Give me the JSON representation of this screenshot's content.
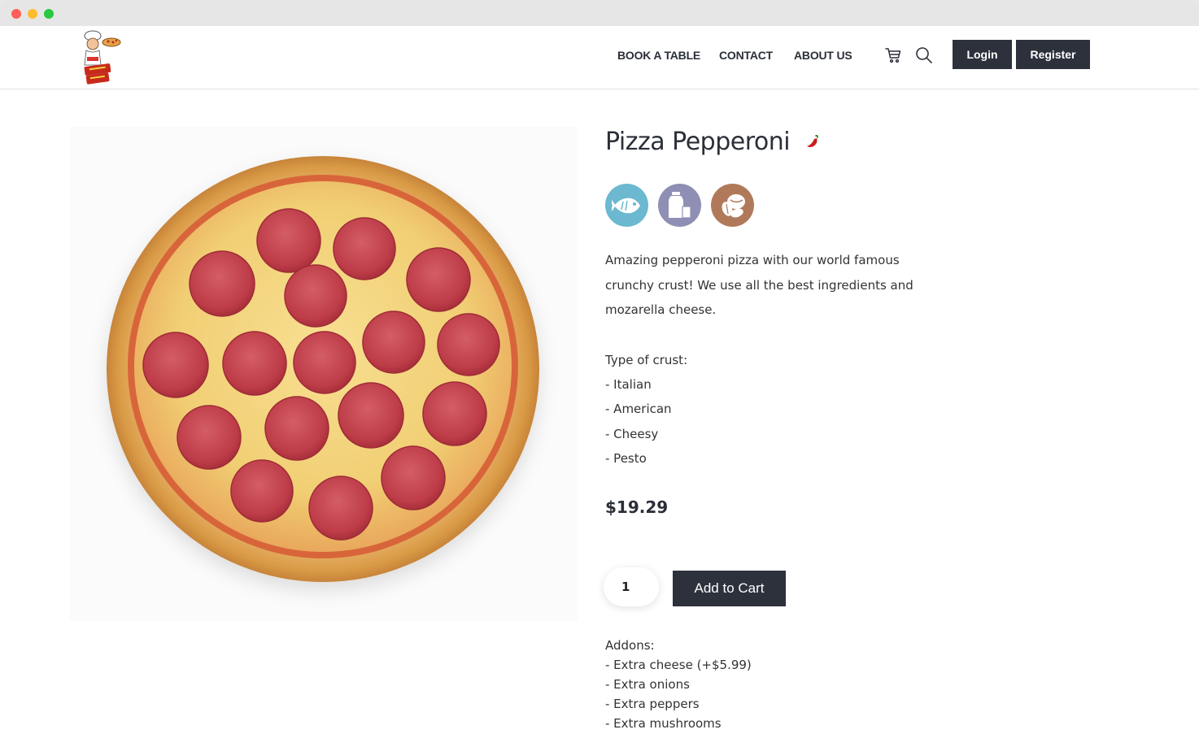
{
  "window": {
    "title": ""
  },
  "header": {
    "logo_alt": "Pizza logo",
    "nav": [
      {
        "label": "BOOK A TABLE"
      },
      {
        "label": "CONTACT"
      },
      {
        "label": "ABOUT US"
      }
    ],
    "cart_icon": "cart-icon",
    "search_icon": "search-icon",
    "login_label": "Login",
    "register_label": "Register"
  },
  "product": {
    "name": "Pizza Pepperoni",
    "spicy_icon": "chili-icon",
    "allergens": [
      {
        "name": "fish-icon",
        "color": "#6bb8d0"
      },
      {
        "name": "milk-icon",
        "color": "#8f8fb5"
      },
      {
        "name": "nuts-icon",
        "color": "#b07a5a"
      }
    ],
    "description_lines": [
      "Amazing pepperoni pizza with our world famous",
      "crunchy crust! We use all the best ingredients and",
      "mozarella cheese."
    ],
    "crust_heading": "Type of crust:",
    "crust_options": [
      "- Italian",
      "- American",
      "- Cheesy",
      "- Pesto"
    ],
    "price": "$19.29",
    "quantity": "1",
    "add_to_cart_label": "Add to Cart",
    "addons_heading": "Addons:",
    "addons": [
      "- Extra cheese (+$5.99)",
      "- Extra onions",
      "- Extra peppers",
      "- Extra mushrooms"
    ]
  },
  "colors": {
    "dark_button": "#2d313c",
    "text": "#2b2f38"
  }
}
